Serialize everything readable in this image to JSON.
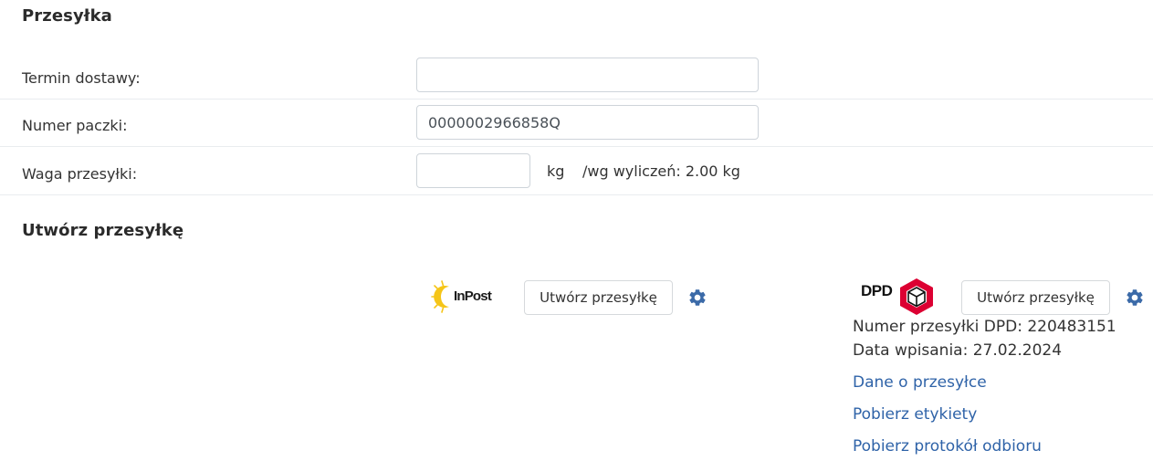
{
  "shipment": {
    "title": "Przesyłka",
    "delivery_label": "Termin dostawy:",
    "delivery_value": "",
    "package_label": "Numer paczki:",
    "package_value": "0000002966858Q",
    "weight_label": "Waga przesyłki:",
    "weight_value": "",
    "weight_unit": "kg",
    "weight_calc": "/wg wyliczeń: 2.00 kg"
  },
  "create": {
    "title": "Utwórz przesyłkę",
    "inpost": {
      "logo_text": "InPost",
      "button_label": "Utwórz przesyłkę",
      "settings_icon": "gear-icon"
    },
    "dpd": {
      "logo_text": "DPD",
      "button_label": "Utwórz przesyłkę",
      "settings_icon": "gear-icon",
      "tracking_text": "Numer przesyłki DPD: 220483151",
      "date_text": "Data wpisania: 27.02.2024",
      "links": [
        "Dane o przesyłce",
        "Pobierz etykiety",
        "Pobierz protokół odbioru"
      ]
    }
  },
  "colors": {
    "link": "#2f63a8",
    "gear": "#3b6aa8",
    "inpost_yellow": "#f5c518",
    "dpd_red": "#dc0032"
  }
}
